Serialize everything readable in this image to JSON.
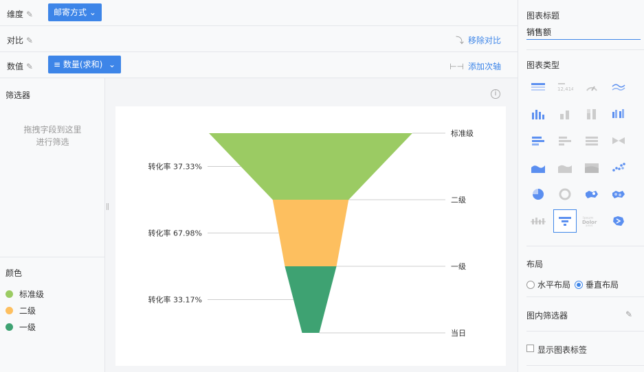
{
  "shelves": {
    "dimension": {
      "label": "维度",
      "pill": "邮寄方式"
    },
    "compare": {
      "label": "对比",
      "action": "移除对比"
    },
    "value": {
      "label": "数值",
      "pill": "数量(求和)",
      "action": "添加次轴"
    }
  },
  "filter": {
    "title": "筛选器",
    "hint_line1": "拖拽字段到这里",
    "hint_line2": "进行筛选"
  },
  "color": {
    "title": "颜色",
    "items": [
      {
        "label": "标准级",
        "color": "#9bcb63"
      },
      {
        "label": "二级",
        "color": "#fdbf5f"
      },
      {
        "label": "一级",
        "color": "#3ea272"
      }
    ]
  },
  "chart_data": {
    "type": "funnel",
    "stages": [
      {
        "name": "标准级",
        "value": 100,
        "color": "#9bcb63"
      },
      {
        "name": "二级",
        "value": 37.33,
        "color": "#fdbf5f"
      },
      {
        "name": "一级",
        "value": 25.38,
        "color": "#3ea272"
      },
      {
        "name": "当日",
        "value": 8.42,
        "color": "#3ea272"
      }
    ],
    "conversion_labels": [
      "转化率 37.33%",
      "转化率 67.98%",
      "转化率 33.17%"
    ]
  },
  "side": {
    "chart_title_label": "图表标题",
    "chart_title_value": "销售额",
    "chart_type_label": "图表类型",
    "layout_label": "布局",
    "layout_horizontal": "水平布局",
    "layout_vertical": "垂直布局",
    "inner_filter_label": "图内筛选器",
    "show_labels": "显示图表标签"
  },
  "icons": {
    "edit": "pencil-icon",
    "info": "info-icon"
  },
  "accent": "#3d85e8"
}
